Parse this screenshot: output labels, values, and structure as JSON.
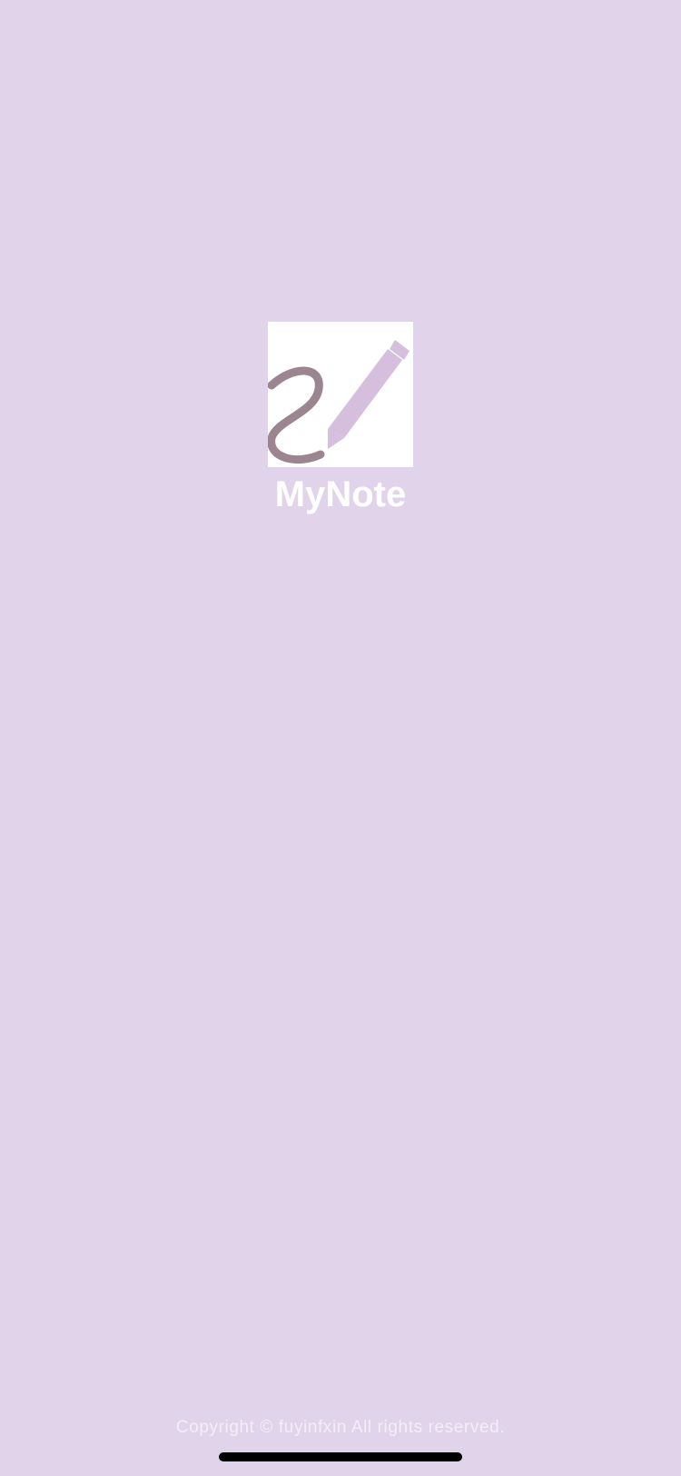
{
  "app": {
    "name": "MyNote",
    "logo_icon": "signature-pen-icon"
  },
  "footer": {
    "copyright": "Copyright © fuyinfxin All rights reserved."
  },
  "colors": {
    "background": "#e1d4ea",
    "logo_background": "#ffffff",
    "stroke": "#9b8591",
    "pen": "#d5bfdc",
    "app_name": "#ffffff",
    "copyright": "#f4eef8"
  }
}
